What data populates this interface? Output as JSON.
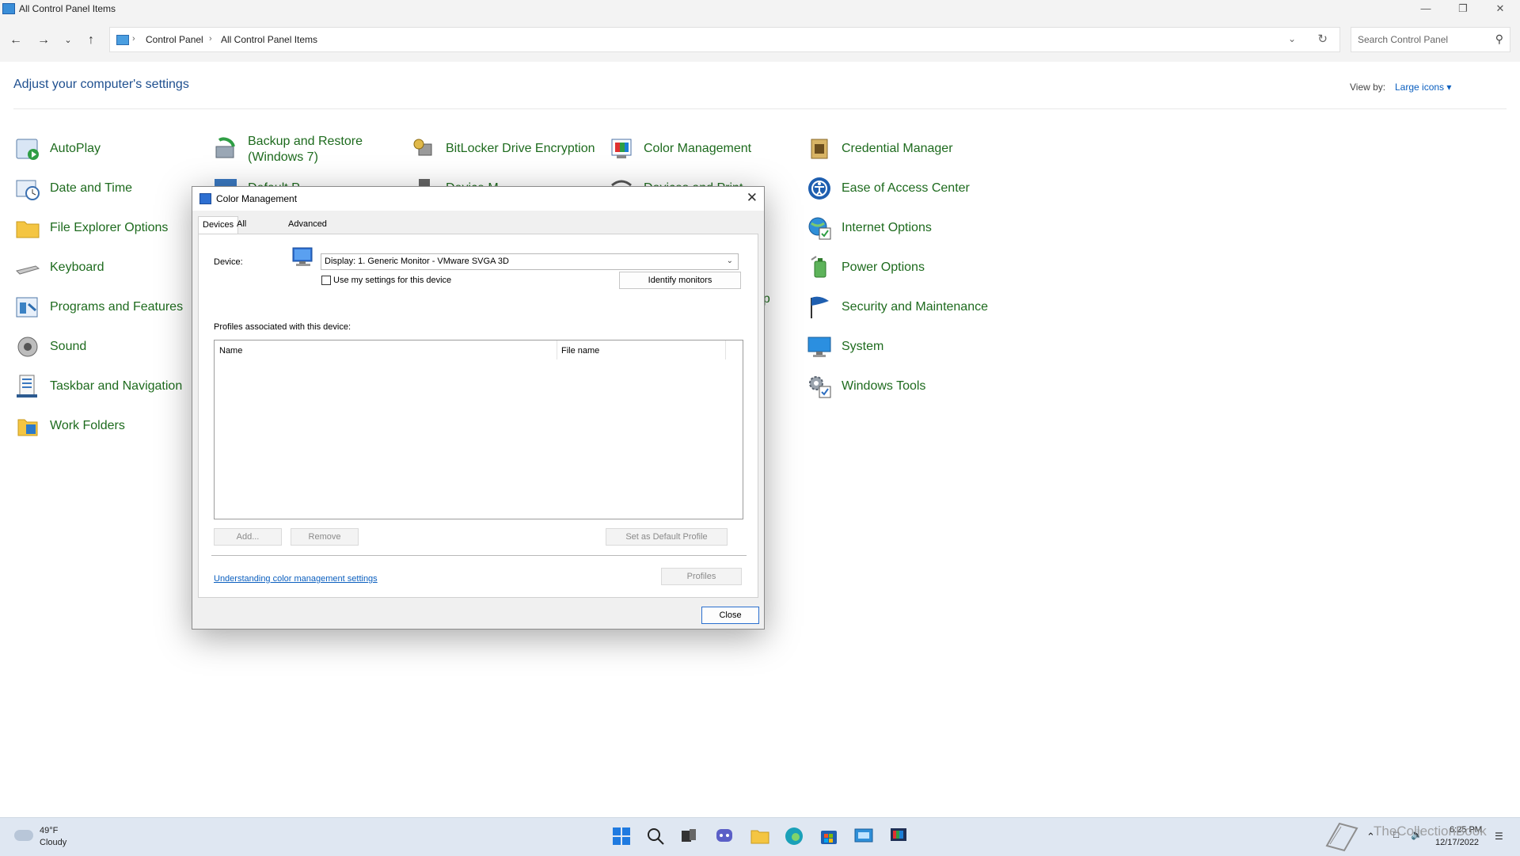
{
  "window": {
    "title": "All Control Panel Items",
    "breadcrumb": [
      "Control Panel",
      "All Control Panel Items"
    ],
    "search_placeholder": "Search Control Panel"
  },
  "page": {
    "title": "Adjust your computer's settings",
    "view_by_label": "View by:",
    "view_by_value": "Large icons"
  },
  "items": [
    {
      "label": "AutoPlay",
      "icon": "autoplay-icon"
    },
    {
      "label": "Backup and Restore\n(Windows 7)",
      "icon": "backup-icon"
    },
    {
      "label": "BitLocker Drive Encryption",
      "icon": "bitlocker-icon"
    },
    {
      "label": "Color Management",
      "icon": "color-management-icon"
    },
    {
      "label": "Credential Manager",
      "icon": "credential-icon"
    },
    {
      "label": "Date and Time",
      "icon": "clock-icon"
    },
    {
      "label": "Default P",
      "icon": "default-programs-icon"
    },
    {
      "label": "Device M",
      "icon": "device-manager-icon"
    },
    {
      "label": "Devices and Print",
      "icon": "printer-icon"
    },
    {
      "label": "Ease of Access Center",
      "icon": "ease-of-access-icon"
    },
    {
      "label": "File Explorer Options",
      "icon": "folder-icon"
    },
    {
      "label": "Internet Options",
      "icon": "internet-icon"
    },
    {
      "label": "Keyboard",
      "icon": "keyboard-icon"
    },
    {
      "label": "Power Options",
      "icon": "power-icon"
    },
    {
      "label": "Programs and Features",
      "icon": "programs-icon"
    },
    {
      "label": "op",
      "icon": ""
    },
    {
      "label": "Security and Maintenance",
      "icon": "flag-icon"
    },
    {
      "label": "Sound",
      "icon": "speaker-icon"
    },
    {
      "label": "System",
      "icon": "monitor-icon"
    },
    {
      "label": "Taskbar and Navigation",
      "icon": "taskbar-icon"
    },
    {
      "label": "Windows Tools",
      "icon": "gears-icon"
    },
    {
      "label": "Work Folders",
      "icon": "work-folders-icon"
    }
  ],
  "dialog": {
    "title": "Color Management",
    "tabs": [
      "Devices",
      "All Profiles",
      "Advanced"
    ],
    "device_label": "Device:",
    "device_value": "Display: 1. Generic Monitor - VMware SVGA 3D",
    "use_settings_label": "Use my settings for this device",
    "identify_button": "Identify monitors",
    "profiles_label": "Profiles associated with this device:",
    "columns": [
      "Name",
      "File name"
    ],
    "add_button": "Add...",
    "remove_button": "Remove",
    "set_default_button": "Set as Default Profile",
    "link": "Understanding color management settings",
    "profiles_button": "Profiles",
    "close_button": "Close"
  },
  "taskbar": {
    "temperature": "49°F",
    "condition": "Cloudy",
    "time": "6:25 PM",
    "date": "12/17/2022"
  },
  "watermark": "TheCollectionBook",
  "colors": {
    "link_green": "#1e6b1e",
    "accent_blue": "#0b5fbf",
    "dialog_bg": "#f0f0f0",
    "taskbar_bg": "#dfe7f2"
  }
}
